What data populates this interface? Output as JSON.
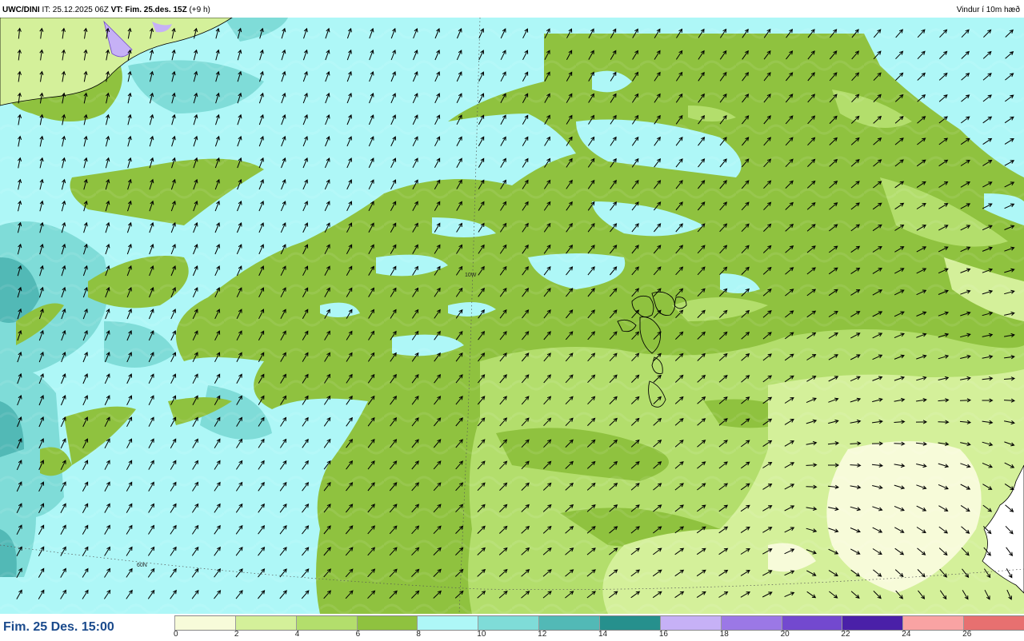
{
  "header": {
    "model": "UWC/DINI",
    "issue_label": "IT:",
    "issue_time": "25.12.2025 06Z",
    "valid_label": "VT:",
    "valid_time": "Fim. 25.des. 15Z",
    "lead": "(+9 h)",
    "product": "Vindur í 10m hæð"
  },
  "map": {
    "longitude_label": "10W",
    "latitude_label": "60N",
    "land_outline_color": "#000000",
    "grid_color": "#555555"
  },
  "footer": {
    "valid_time_text": "Fim. 25 Des. 15:00"
  },
  "legend": {
    "ticks": [
      "0",
      "2",
      "4",
      "6",
      "8",
      "10",
      "12",
      "14",
      "16",
      "18",
      "20",
      "22",
      "24",
      "26"
    ],
    "colors": [
      "#f7fbd9",
      "#d4f09a",
      "#b3de6c",
      "#8fc23f",
      "#aef7f7",
      "#7fdcd8",
      "#52b9b6",
      "#26908d",
      "#c6b1f6",
      "#9b78e6",
      "#7349cf",
      "#4a20a8",
      "#f9a3a3",
      "#e77070"
    ]
  }
}
